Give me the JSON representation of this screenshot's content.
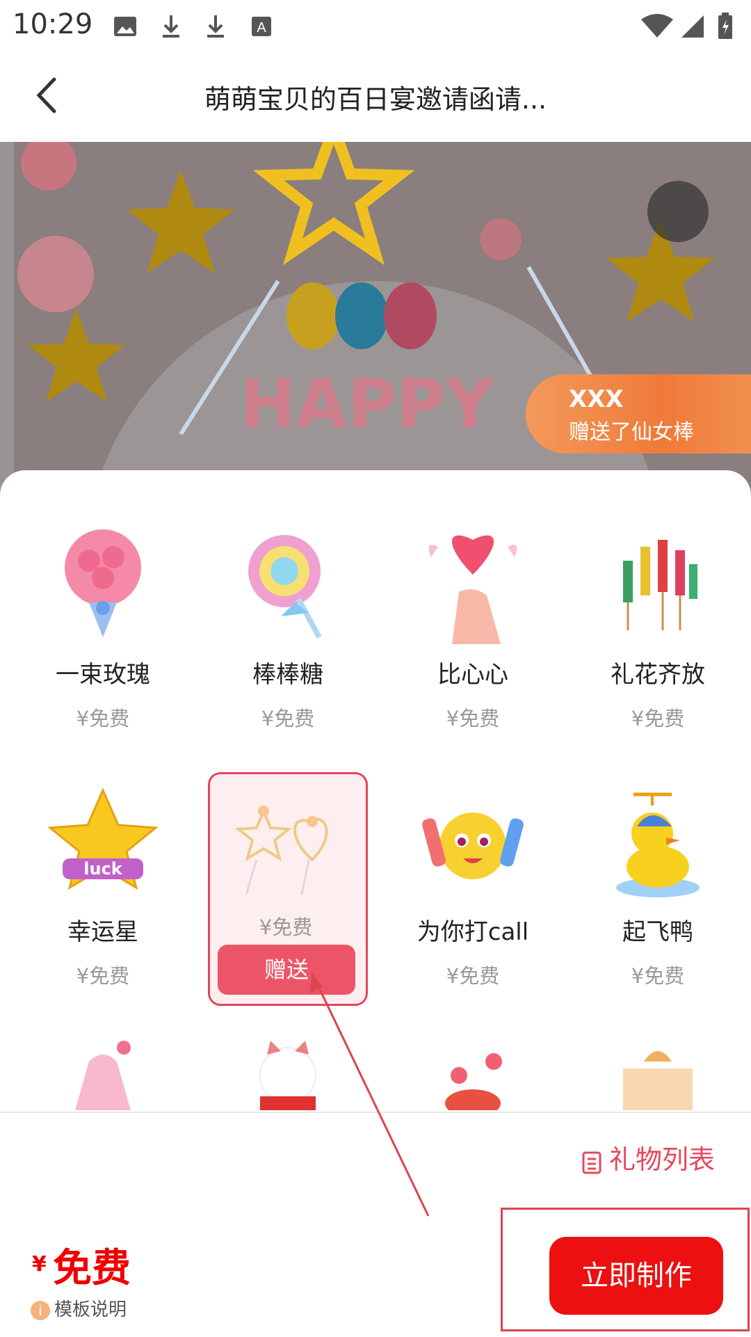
{
  "status_bar": {
    "time": "10:29"
  },
  "header": {
    "title": "萌萌宝贝的百日宴邀请函请..."
  },
  "toast": {
    "name": "XXX",
    "message": "赠送了仙女棒"
  },
  "gifts": [
    {
      "name": "一束玫瑰",
      "price": "¥免费"
    },
    {
      "name": "棒棒糖",
      "price": "¥免费"
    },
    {
      "name": "比心心",
      "price": "¥免费"
    },
    {
      "name": "礼花齐放",
      "price": "¥免费"
    },
    {
      "name": "幸运星",
      "price": "¥免费"
    },
    {
      "name": "",
      "price": "¥免费"
    },
    {
      "name": "为你打call",
      "price": "¥免费"
    },
    {
      "name": "起飞鸭",
      "price": "¥免费"
    }
  ],
  "selected_gift": {
    "button_label": "赠送"
  },
  "bottom": {
    "gift_list_label": "礼物列表",
    "price_symbol": "¥",
    "price_value": "免费",
    "template_label": "模板说明",
    "template_icon": "i",
    "make_button": "立即制作"
  },
  "colors": {
    "accent": "#ec1010",
    "selected": "#ec5568",
    "toast": "#f07a3a"
  }
}
